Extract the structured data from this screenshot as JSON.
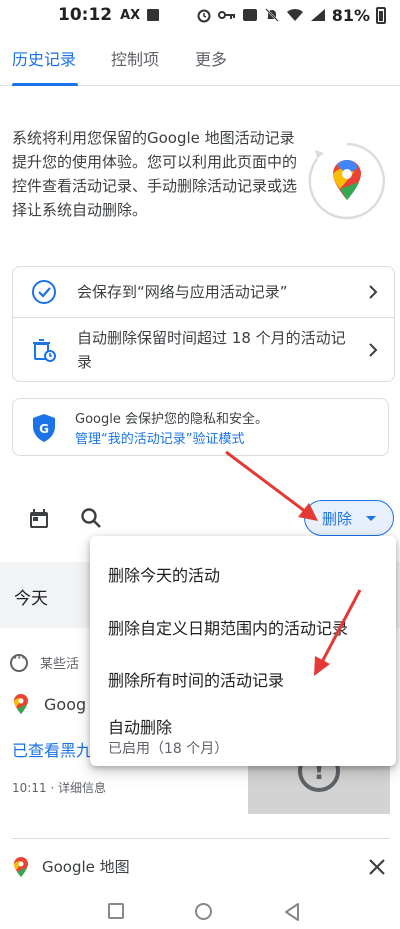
{
  "status_bar": {
    "time": "10:12",
    "carrier": "AX",
    "battery": "81%",
    "network": "4G"
  },
  "tabs": [
    {
      "label": "历史记录",
      "active": true
    },
    {
      "label": "控制项",
      "active": false
    },
    {
      "label": "更多",
      "active": false
    }
  ],
  "intro": {
    "text": "系统将利用您保留的Google 地图活动记录提升您的使用体验。您可以利用此页面中的控件查看活动记录、手动删除活动记录或选择让系统自动删除。"
  },
  "settings_card": {
    "save_row": "会保存到“网络与应用活动记录”",
    "auto_delete_row": "自动删除保留时间超过 18 个月的活动记录"
  },
  "privacy_card": {
    "line1": "Google 会保护您的隐私和安全。",
    "link": "管理“我的活动记录”验证模式"
  },
  "toolbar": {
    "delete_label": "删除"
  },
  "background": {
    "today_label": "今天",
    "item_header": "某些活",
    "app_name_partial": "Goog",
    "link_text": "已查看黑九",
    "time_detail": "10:11 · 详细信息",
    "bottom_app": "Google 地图"
  },
  "delete_menu": {
    "items": [
      {
        "label": "删除今天的活动"
      },
      {
        "label": "删除自定义日期范围内的活动记录"
      },
      {
        "label": "删除所有时间的活动记录"
      },
      {
        "label": "自动删除",
        "sublabel": "已启用（18 个月）"
      }
    ]
  },
  "colors": {
    "accent": "#1a73e8",
    "annotation_arrow": "#e53935"
  }
}
